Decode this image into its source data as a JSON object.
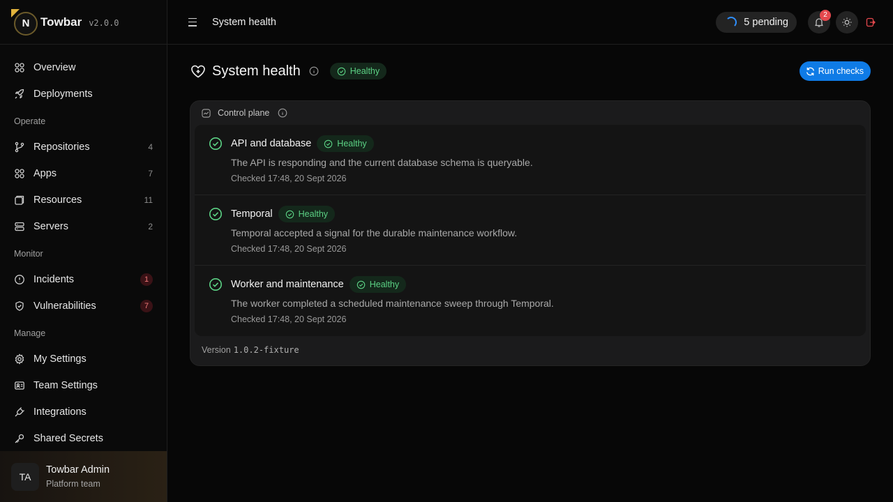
{
  "brand": {
    "logo_letter": "N",
    "name": "Towbar",
    "version": "v2.0.0"
  },
  "sidebar": {
    "top_items": [
      {
        "label": "Overview",
        "icon": "grid-icon"
      },
      {
        "label": "Deployments",
        "icon": "rocket-icon"
      }
    ],
    "sections": [
      {
        "title": "Operate",
        "items": [
          {
            "label": "Repositories",
            "count": "4",
            "icon": "git-branch-icon"
          },
          {
            "label": "Apps",
            "count": "7",
            "icon": "grid-icon"
          },
          {
            "label": "Resources",
            "count": "11",
            "icon": "cube-icon"
          },
          {
            "label": "Servers",
            "count": "2",
            "icon": "server-icon"
          }
        ]
      },
      {
        "title": "Monitor",
        "items": [
          {
            "label": "Incidents",
            "count": "1",
            "icon": "alert-circle-icon"
          },
          {
            "label": "Vulnerabilities",
            "count": "7",
            "icon": "shield-icon"
          }
        ]
      },
      {
        "title": "Manage",
        "items": [
          {
            "label": "My Settings",
            "icon": "gear-icon"
          },
          {
            "label": "Team Settings",
            "icon": "id-card-icon"
          },
          {
            "label": "Integrations",
            "icon": "plug-icon"
          },
          {
            "label": "Shared Secrets",
            "icon": "key-icon"
          }
        ]
      }
    ],
    "user": {
      "initials": "TA",
      "name": "Towbar Admin",
      "team": "Platform team"
    }
  },
  "topbar": {
    "breadcrumb": "System health",
    "pending_label": "5 pending",
    "notifications_count": "2"
  },
  "page": {
    "title": "System health",
    "status": "Healthy",
    "run_button": "Run checks",
    "card": {
      "title": "Control plane",
      "checks": [
        {
          "title": "API and database",
          "status": "Healthy",
          "description": "The API is responding and the current database schema is queryable.",
          "checked": "Checked 17:48, 20 Sept 2026"
        },
        {
          "title": "Temporal",
          "status": "Healthy",
          "description": "Temporal accepted a signal for the durable maintenance workflow.",
          "checked": "Checked 17:48, 20 Sept 2026"
        },
        {
          "title": "Worker and maintenance",
          "status": "Healthy",
          "description": "The worker completed a scheduled maintenance sweep through Temporal.",
          "checked": "Checked 17:48, 20 Sept 2026"
        }
      ],
      "version_label": "Version",
      "version_value": "1.0.2-fixture"
    }
  },
  "colors": {
    "accent": "#0f7be6",
    "healthy": "#5bd184",
    "danger": "#e5484d",
    "brand_gold": "#e1b33c"
  }
}
